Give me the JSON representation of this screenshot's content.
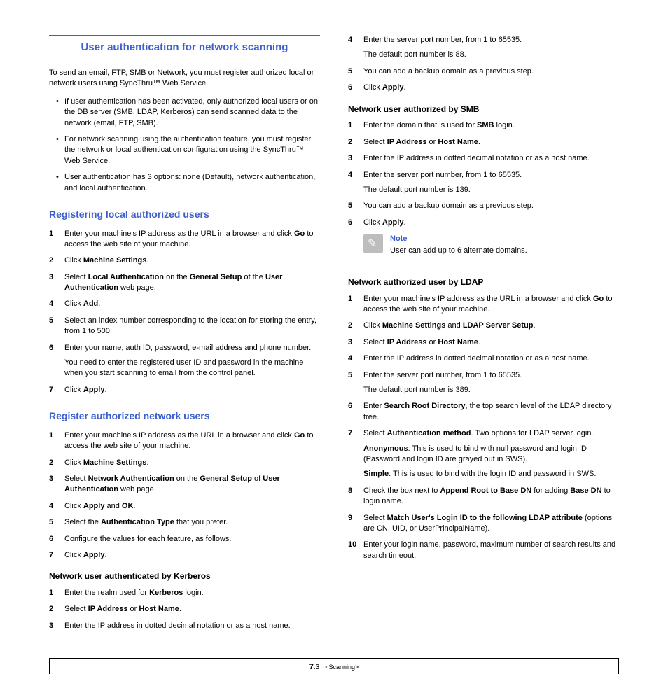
{
  "title": "User authentication for network scanning",
  "intro": "To send an email, FTP, SMB or Network, you must register authorized local or network users using SyncThru™ Web Service.",
  "bullets": [
    "If user authentication has been activated, only authorized local users or on the DB server (SMB, LDAP, Kerberos) can send scanned data to the network (email, FTP, SMB).",
    "For network scanning using the authentication feature, you must register the network or local authentication configuration using the SyncThru™ Web Service.",
    "User authentication has 3 options: none (Default), network authentication, and local authentication."
  ],
  "sec_local": {
    "heading": "Registering local authorized users",
    "steps": [
      {
        "n": "1",
        "parts": [
          [
            "Enter your machine's IP address as the URL in a browser and click ",
            [
              "b",
              "Go"
            ],
            " to access the web site of your machine."
          ]
        ]
      },
      {
        "n": "2",
        "parts": [
          [
            "Click ",
            [
              "b",
              "Machine Settings"
            ],
            "."
          ]
        ]
      },
      {
        "n": "3",
        "parts": [
          [
            "Select ",
            [
              "b",
              "Local Authentication"
            ],
            " on the  ",
            [
              "b",
              "General Setup"
            ],
            " of the ",
            [
              "b",
              "User Authentication"
            ],
            " web page."
          ]
        ]
      },
      {
        "n": "4",
        "parts": [
          [
            "Click ",
            [
              "b",
              "Add"
            ],
            "."
          ]
        ]
      },
      {
        "n": "5",
        "parts": [
          [
            "Select an index number corresponding to the location for storing the entry, from 1 to 500."
          ]
        ]
      },
      {
        "n": "6",
        "parts": [
          [
            "Enter your name, auth ID, password, e-mail address and phone number."
          ],
          [
            "You need to enter the registered user ID and password in the machine when you start scanning to email from the control panel."
          ]
        ]
      },
      {
        "n": "7",
        "parts": [
          [
            "Click ",
            [
              "b",
              "Apply"
            ],
            "."
          ]
        ]
      }
    ]
  },
  "sec_network": {
    "heading": "Register authorized network users",
    "steps": [
      {
        "n": "1",
        "parts": [
          [
            "Enter your machine's IP address as the URL in a browser and click ",
            [
              "b",
              "Go"
            ],
            " to access the web site of your machine."
          ]
        ]
      },
      {
        "n": "2",
        "parts": [
          [
            "Click ",
            [
              "b",
              "Machine Settings"
            ],
            "."
          ]
        ]
      },
      {
        "n": "3",
        "parts": [
          [
            "Select ",
            [
              "b",
              "Network Authentication"
            ],
            " on the  ",
            [
              "b",
              "General Setup"
            ],
            " of ",
            [
              "b",
              "User Authentication"
            ],
            " web page."
          ]
        ]
      },
      {
        "n": "4",
        "parts": [
          [
            "Click ",
            [
              "b",
              "Apply"
            ],
            " and ",
            [
              "b",
              "OK"
            ],
            "."
          ]
        ]
      },
      {
        "n": "5",
        "parts": [
          [
            "Select the ",
            [
              "b",
              "Authentication Type"
            ],
            " that you prefer."
          ]
        ]
      },
      {
        "n": "6",
        "parts": [
          [
            "Configure the values for each feature, as follows."
          ]
        ]
      },
      {
        "n": "7",
        "parts": [
          [
            "Click ",
            [
              "b",
              "Apply"
            ],
            "."
          ]
        ]
      }
    ]
  },
  "sec_kerberos": {
    "heading": "Network user authenticated by Kerberos",
    "steps": [
      {
        "n": "1",
        "parts": [
          [
            "Enter the realm used for ",
            [
              "b",
              "Kerberos"
            ],
            " login."
          ]
        ]
      },
      {
        "n": "2",
        "parts": [
          [
            "Select ",
            [
              "b",
              "IP Address"
            ],
            " or ",
            [
              "b",
              "Host Name"
            ],
            "."
          ]
        ]
      },
      {
        "n": "3",
        "parts": [
          [
            "Enter the IP address in dotted decimal notation or as a host name."
          ]
        ]
      },
      {
        "n": "4",
        "parts": [
          [
            "Enter the server port number, from 1 to 65535."
          ],
          [
            "The default port number is 88."
          ]
        ]
      },
      {
        "n": "5",
        "parts": [
          [
            "You can add a backup domain as a previous step."
          ]
        ]
      },
      {
        "n": "6",
        "parts": [
          [
            "Click ",
            [
              "b",
              "Apply"
            ],
            "."
          ]
        ]
      }
    ]
  },
  "sec_smb": {
    "heading": "Network user authorized by SMB",
    "steps": [
      {
        "n": "1",
        "parts": [
          [
            "Enter the domain that is used for ",
            [
              "b",
              "SMB"
            ],
            " login."
          ]
        ]
      },
      {
        "n": "2",
        "parts": [
          [
            "Select ",
            [
              "b",
              "IP Address"
            ],
            " or ",
            [
              "b",
              "Host Name"
            ],
            "."
          ]
        ]
      },
      {
        "n": "3",
        "parts": [
          [
            "Enter the IP address in dotted decimal notation or as a host name."
          ]
        ]
      },
      {
        "n": "4",
        "parts": [
          [
            "Enter the server port number, from 1 to 65535."
          ],
          [
            "The default port number is 139."
          ]
        ]
      },
      {
        "n": "5",
        "parts": [
          [
            "You can add a backup domain as a previous step."
          ]
        ]
      },
      {
        "n": "6",
        "parts": [
          [
            "Click ",
            [
              "b",
              "Apply"
            ],
            "."
          ]
        ]
      }
    ],
    "note_title": "Note",
    "note_body": "User can add up to 6 alternate domains."
  },
  "sec_ldap": {
    "heading": "Network authorized user by LDAP",
    "steps": [
      {
        "n": "1",
        "parts": [
          [
            "Enter your machine's IP address as the URL in a browser and click ",
            [
              "b",
              "Go"
            ],
            " to access the web site of your machine."
          ]
        ]
      },
      {
        "n": "2",
        "parts": [
          [
            "Click ",
            [
              "b",
              "Machine Settings"
            ],
            " and ",
            [
              "b",
              "LDAP Server Setup"
            ],
            "."
          ]
        ]
      },
      {
        "n": "3",
        "parts": [
          [
            "Select ",
            [
              "b",
              "IP Address"
            ],
            " or ",
            [
              "b",
              "Host Name"
            ],
            "."
          ]
        ]
      },
      {
        "n": "4",
        "parts": [
          [
            "Enter the IP address in dotted decimal notation or as a host name."
          ]
        ]
      },
      {
        "n": "5",
        "parts": [
          [
            "Enter the server port number, from 1 to 65535."
          ],
          [
            "The default port number is 389."
          ]
        ]
      },
      {
        "n": "6",
        "parts": [
          [
            "Enter ",
            [
              "b",
              "Search Root Directory"
            ],
            ", the top search level of the LDAP directory tree."
          ]
        ]
      },
      {
        "n": "7",
        "parts": [
          [
            "Select ",
            [
              "b",
              "Authentication method"
            ],
            ". Two options for LDAP server login."
          ],
          [
            " ",
            [
              "b",
              "Anonymous"
            ],
            ": This is used to bind with null password and login ID (Password and login ID are grayed out in SWS)."
          ],
          [
            [
              "b",
              "Simple"
            ],
            ": This is used to bind with the login ID and password in SWS."
          ]
        ]
      },
      {
        "n": "8",
        "parts": [
          [
            "Check the box next to ",
            [
              "b",
              "Append Root to Base DN"
            ],
            " for adding ",
            [
              "b",
              "Base DN"
            ],
            " to login name."
          ]
        ]
      },
      {
        "n": "9",
        "parts": [
          [
            "Select ",
            [
              "b",
              "Match User's Login ID to the following LDAP attribute"
            ],
            " (options are CN, UID, or UserPrincipalName)."
          ]
        ]
      },
      {
        "n": "10",
        "parts": [
          [
            "Enter your login name, password, maximum number of search results and search timeout."
          ]
        ]
      }
    ]
  },
  "footer": {
    "chapter": "7",
    "page": ".3",
    "section": "<Scanning>"
  }
}
